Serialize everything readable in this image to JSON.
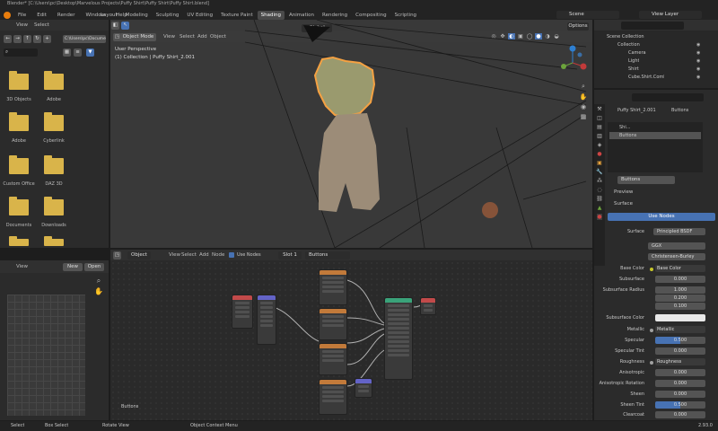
{
  "window": {
    "title": "Blender* [C:\\Users\\pc\\Desktop\\Marvelous Projects\\Puffy Shirt\\Puffy Shirt\\Puffy Shirt.blend]"
  },
  "menu": [
    "File",
    "Edit",
    "Render",
    "Window",
    "Help"
  ],
  "workspaces": [
    "Layout",
    "Modeling",
    "Sculpting",
    "UV Editing",
    "Texture Paint",
    "Shading",
    "Animation",
    "Rendering",
    "Compositing",
    "Scripting"
  ],
  "active_workspace": "Shading",
  "topright": {
    "scene": "Scene",
    "view_layer": "View Layer"
  },
  "file_browser": {
    "view_menu": "View",
    "select_menu": "Select",
    "path": "C:\\Users\\pc\\Docume",
    "folders": [
      "3D Objects",
      "Adobe",
      "Adobe",
      "Cyberlink",
      "Custom Office",
      "DAZ 3D",
      "Documents",
      "Downloads"
    ]
  },
  "viewport": {
    "mode": "Object Mode",
    "menus": [
      "View",
      "Select",
      "Add",
      "Object"
    ],
    "info_line1": "User Perspective",
    "info_line2": "(1) Collection | Puffy Shirt_2.001",
    "transform": "Global",
    "options": "Options"
  },
  "image_editor": {
    "view": "View",
    "new": "New",
    "open": "Open"
  },
  "node_editor": {
    "object": "Object",
    "menus": [
      "View",
      "Select",
      "Add",
      "Node"
    ],
    "use_nodes": "Use Nodes",
    "slot": "Slot 1",
    "material": "Buttons",
    "footer": "Buttons"
  },
  "outliner": {
    "root": "Scene Collection",
    "items": [
      "Collection",
      "Camera",
      "Light",
      "Shirt",
      "Cube.Shirt.Comb"
    ]
  },
  "properties": {
    "object_name": "Puffy Shirt_2.001",
    "material_tab": "Buttons",
    "slots": [
      "Shi...",
      "Buttons"
    ],
    "material_name": "Buttons",
    "preview": "Preview",
    "surface_section": "Surface",
    "use_nodes_btn": "Use Nodes",
    "surface_label": "Surface",
    "surface_value": "Principled BSDF",
    "ggx": "GGX",
    "christensen": "Christensen-Burley",
    "rows": [
      {
        "label": "Base Color",
        "value": "Base Color",
        "kind": "link"
      },
      {
        "label": "Subsurface",
        "value": "0.000",
        "kind": "num"
      },
      {
        "label": "Subsurface Radius",
        "value": "1.000",
        "kind": "num"
      },
      {
        "label": "",
        "value": "0.200",
        "kind": "num"
      },
      {
        "label": "",
        "value": "0.100",
        "kind": "num"
      },
      {
        "label": "Subsurface Color",
        "value": "",
        "kind": "color"
      },
      {
        "label": "Metallic",
        "value": "Metallic",
        "kind": "link"
      },
      {
        "label": "Specular",
        "value": "0.500",
        "kind": "blue"
      },
      {
        "label": "Specular Tint",
        "value": "0.000",
        "kind": "num"
      },
      {
        "label": "Roughness",
        "value": "Roughness",
        "kind": "link"
      },
      {
        "label": "Anisotropic",
        "value": "0.000",
        "kind": "num"
      },
      {
        "label": "Anisotropic Rotation",
        "value": "0.000",
        "kind": "num"
      },
      {
        "label": "Sheen",
        "value": "0.000",
        "kind": "num"
      },
      {
        "label": "Sheen Tint",
        "value": "0.500",
        "kind": "blue"
      },
      {
        "label": "Clearcoat",
        "value": "0.000",
        "kind": "num"
      }
    ]
  },
  "statusbar": {
    "select": "Select",
    "box_select": "Box Select",
    "rotate": "Rotate View",
    "context": "Object Context Menu",
    "version": "2.93.0"
  },
  "colors": {
    "accent": "#4772b3",
    "selection": "#f5a142",
    "folder": "#d9b44a"
  }
}
